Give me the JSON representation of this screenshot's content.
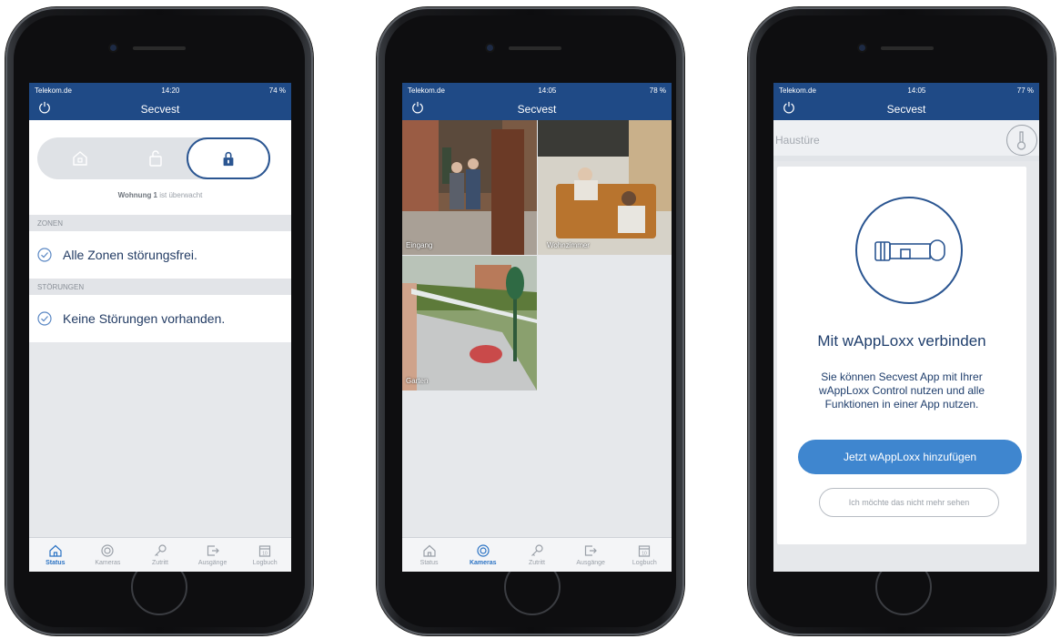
{
  "phones": [
    {
      "status_bar": {
        "carrier": "Telekom.de",
        "time": "14:20",
        "battery": "74 %"
      },
      "title": "Secvest",
      "status_caption_bold": "Wohnung 1",
      "status_caption_rest": "ist überwacht",
      "sections": [
        {
          "header": "ZONEN",
          "text": "Alle Zonen störungsfrei."
        },
        {
          "header": "STÖRUNGEN",
          "text": "Keine Störungen vorhanden."
        }
      ]
    },
    {
      "status_bar": {
        "carrier": "Telekom.de",
        "time": "14:05",
        "battery": "78 %"
      },
      "title": "Secvest",
      "cameras": [
        "Eingang",
        "Wohnzimmer",
        "Garten"
      ]
    },
    {
      "status_bar": {
        "carrier": "Telekom.de",
        "time": "14:05",
        "battery": "77 %"
      },
      "title": "Secvest",
      "door_name": "Haustüre",
      "heading": "Mit wAppLoxx verbinden",
      "body": "Sie können Secvest App mit Ihrer wAppLoxx Control nutzen und alle Funktionen in einer App nutzen.",
      "primary_button": "Jetzt wAppLoxx hinzufügen",
      "secondary_button": "Ich möchte das nicht mehr sehen"
    }
  ],
  "tabs": [
    "Status",
    "Kameras",
    "Zutritt",
    "Ausgänge",
    "Logbuch"
  ],
  "calendar_day": "10",
  "colors": {
    "nav": "#1f4a86",
    "accent": "#2b73c4",
    "button": "#3f86cf"
  }
}
